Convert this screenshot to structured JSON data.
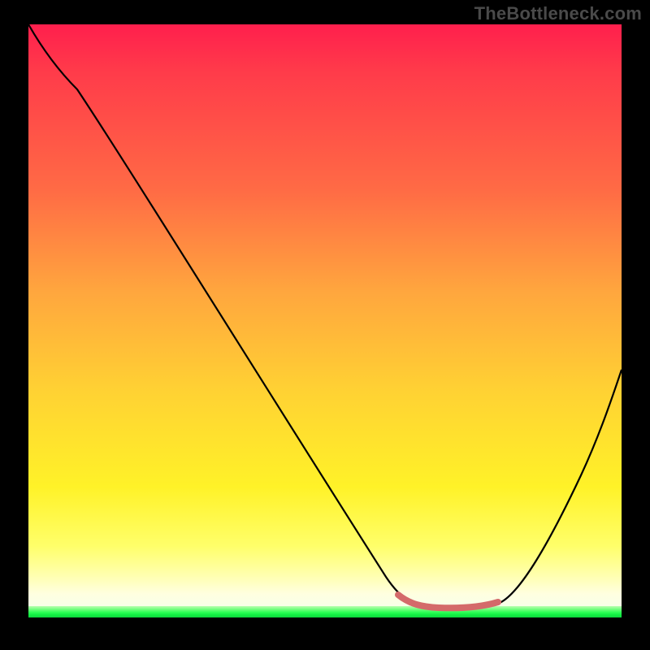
{
  "watermark": "TheBottleneck.com",
  "colors": {
    "background": "#000000",
    "gradient_top": "#ff1f4d",
    "gradient_mid_orange": "#ffa63e",
    "gradient_yellow": "#ffff6a",
    "gradient_green": "#12f044",
    "curve": "#000000",
    "segment": "#d46a6a",
    "watermark": "#4a4a4a"
  },
  "chart_data": {
    "type": "line",
    "title": "",
    "xlabel": "",
    "ylabel": "",
    "x_range": [
      0,
      100
    ],
    "y_range": [
      0,
      100
    ],
    "points": [
      {
        "x": 0,
        "y": 100
      },
      {
        "x": 4,
        "y": 95
      },
      {
        "x": 8,
        "y": 91
      },
      {
        "x": 15,
        "y": 80
      },
      {
        "x": 25,
        "y": 64
      },
      {
        "x": 35,
        "y": 48
      },
      {
        "x": 45,
        "y": 32
      },
      {
        "x": 55,
        "y": 16
      },
      {
        "x": 62,
        "y": 6
      },
      {
        "x": 65,
        "y": 3
      },
      {
        "x": 68,
        "y": 2
      },
      {
        "x": 72,
        "y": 2
      },
      {
        "x": 76,
        "y": 2
      },
      {
        "x": 80,
        "y": 3
      },
      {
        "x": 84,
        "y": 7
      },
      {
        "x": 90,
        "y": 18
      },
      {
        "x": 95,
        "y": 30
      },
      {
        "x": 100,
        "y": 42
      }
    ],
    "highlight_segment": {
      "x_start": 63,
      "x_end": 80
    },
    "grid": false,
    "legend": false
  }
}
